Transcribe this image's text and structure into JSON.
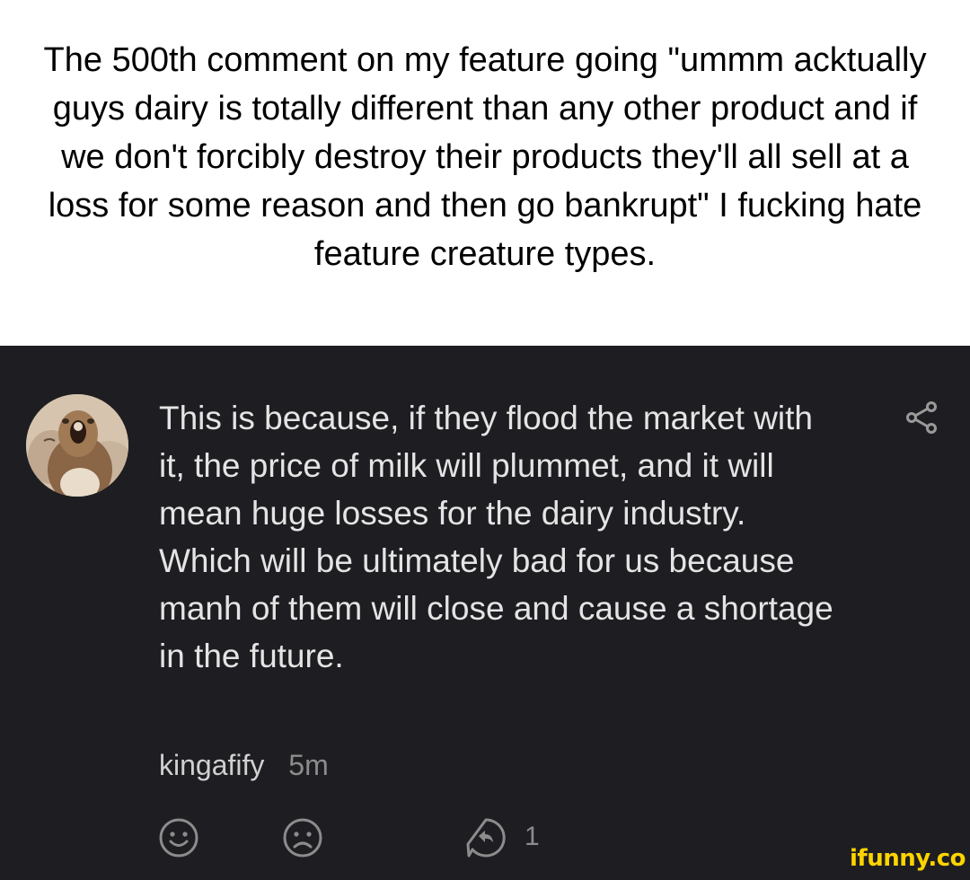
{
  "caption": {
    "text": "The 500th comment on my feature going \"ummm acktually guys dairy is totally different than any other product and if we don't forcibly destroy their products they'll all sell at a loss for some reason and then go bankrupt\" I fucking hate feature creature types."
  },
  "comment": {
    "body": "This is because, if they flood the market with it, the price of milk will plummet, and it will mean huge losses for the dairy industry. Which will be ultimately bad for us because manh of them will close and cause a shortage in the future.",
    "username": "kingafify",
    "timestamp": "5m",
    "reply_count": "1",
    "icons": {
      "avatar": "avatar-screaming-animal",
      "share": "share-icon",
      "like": "smile-icon",
      "dislike": "frown-icon",
      "reply": "reply-icon"
    }
  },
  "watermark": {
    "text": "ifunny.co",
    "color": "#ffd400"
  },
  "colors": {
    "card_background": "#1e1e22",
    "caption_background": "#ffffff",
    "comment_text": "#e4e4e4",
    "muted_text": "#8c8c8c"
  }
}
